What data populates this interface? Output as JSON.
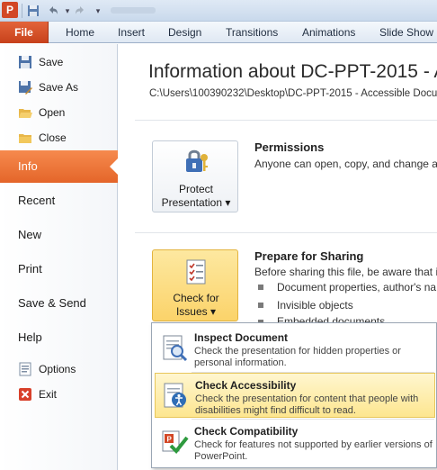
{
  "quick_access": {
    "app_icon": "powerpoint-icon",
    "save_icon": "save-icon",
    "undo_icon": "undo-icon",
    "redo_icon": "redo-icon",
    "customize_icon": "chevron-down-icon"
  },
  "ribbon": {
    "file_label": "File",
    "tabs": [
      "Home",
      "Insert",
      "Design",
      "Transitions",
      "Animations",
      "Slide Show"
    ]
  },
  "backstage": {
    "commands": [
      {
        "label": "Save",
        "icon": "save-icon"
      },
      {
        "label": "Save As",
        "icon": "save-as-icon"
      },
      {
        "label": "Open",
        "icon": "open-folder-icon"
      },
      {
        "label": "Close",
        "icon": "close-folder-icon"
      }
    ],
    "sections": [
      "Info",
      "Recent",
      "New",
      "Print",
      "Save & Send",
      "Help"
    ],
    "active_section": "Info",
    "bottom_commands": [
      {
        "label": "Options",
        "icon": "options-icon"
      },
      {
        "label": "Exit",
        "icon": "exit-icon"
      }
    ]
  },
  "info": {
    "title": "Information about DC-PPT-2015 - A",
    "path": "C:\\Users\\100390232\\Desktop\\DC-PPT-2015 - Accessible Docu",
    "permissions": {
      "button_line1": "Protect",
      "button_line2": "Presentation ▾",
      "heading": "Permissions",
      "text": "Anyone can open, copy, and change a"
    },
    "sharing": {
      "button_line1": "Check for",
      "button_line2": "Issues ▾",
      "heading": "Prepare for Sharing",
      "text": "Before sharing this file, be aware that it",
      "bullets": [
        "Document properties, author's na",
        "Invisible objects",
        "Embedded documents"
      ]
    }
  },
  "menu": {
    "items": [
      {
        "title": "Inspect Document",
        "desc": "Check the presentation for hidden properties or personal information.",
        "icon": "inspect-document-icon",
        "highlighted": false
      },
      {
        "title": "Check Accessibility",
        "desc": "Check the presentation for content that people with disabilities might find difficult to read.",
        "icon": "check-accessibility-icon",
        "highlighted": true
      },
      {
        "title": "Check Compatibility",
        "desc": "Check for features not supported by earlier versions of PowerPoint.",
        "icon": "check-compatibility-icon",
        "highlighted": false
      }
    ]
  },
  "colors": {
    "file_tab": "#d9532b",
    "active_section": "#ef7a3c",
    "menu_highlight": "#fde690"
  }
}
